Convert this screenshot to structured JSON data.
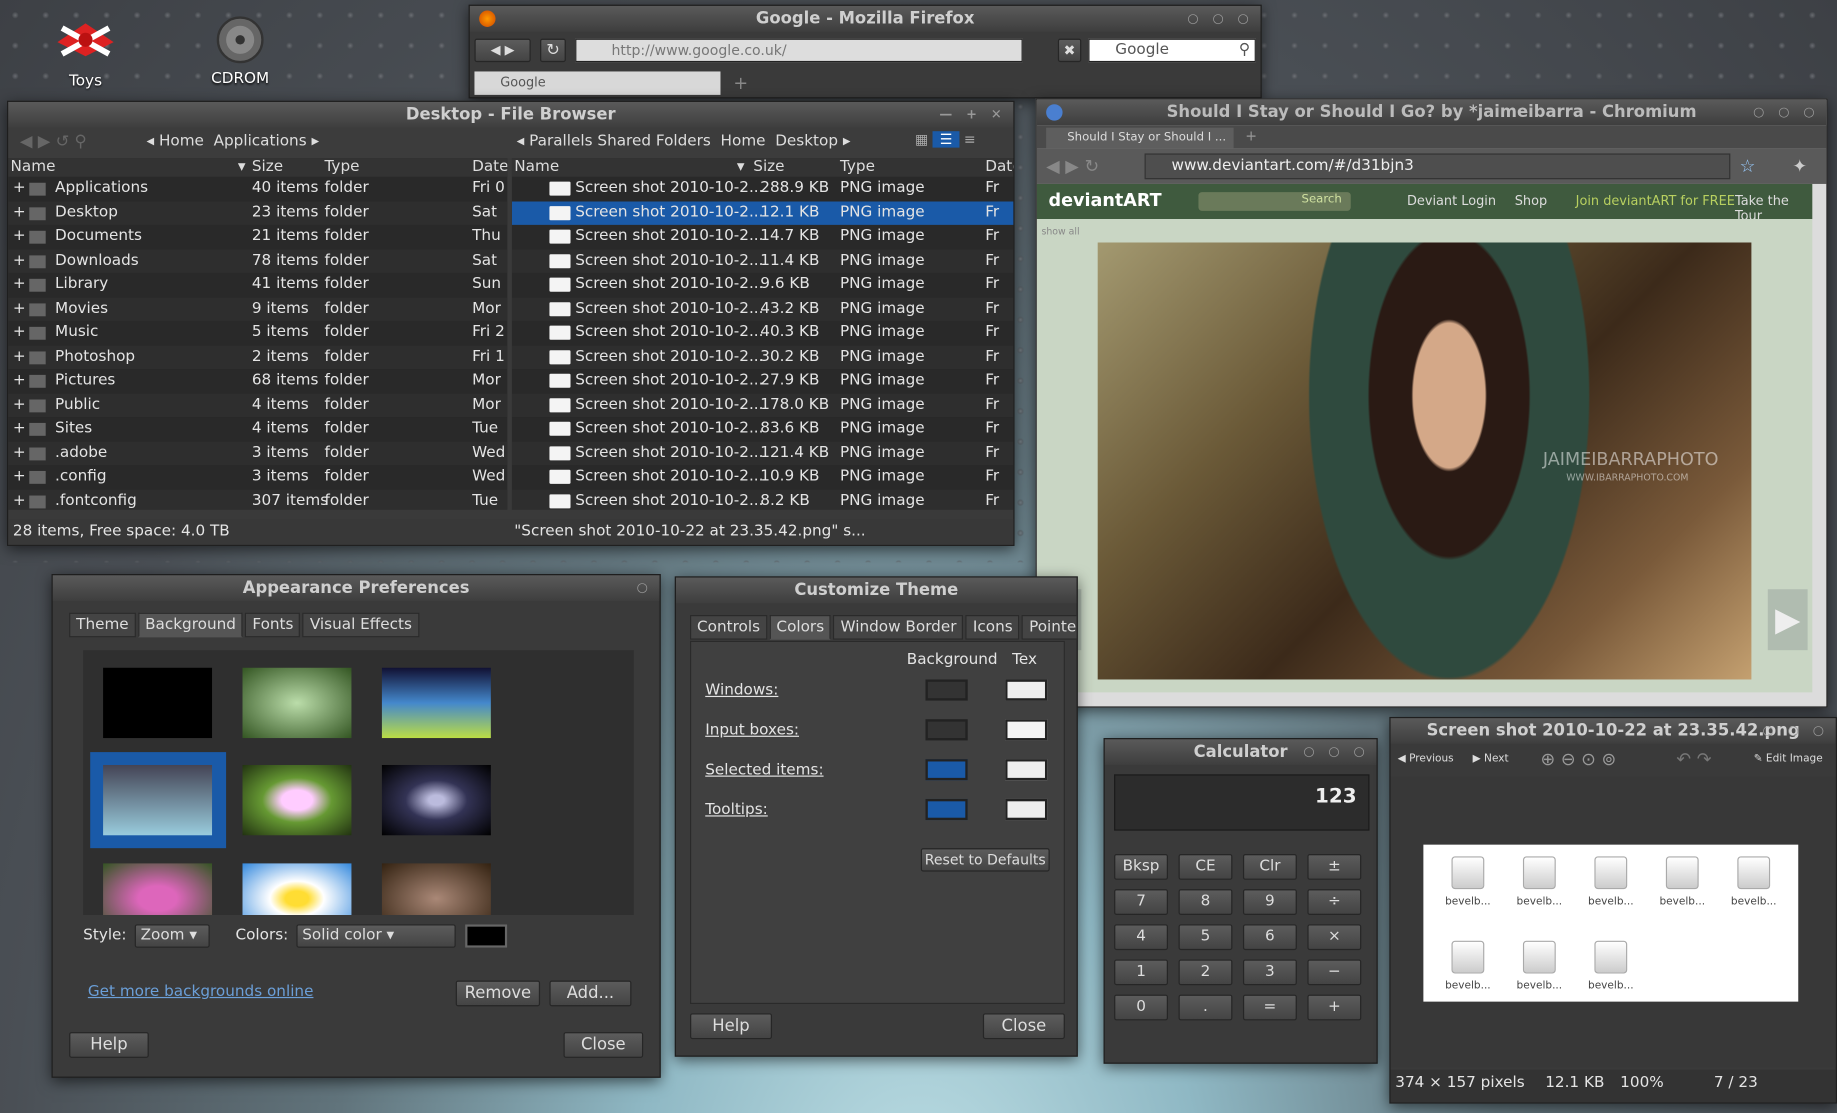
{
  "desktop": {
    "icons": [
      {
        "label": "Toys"
      },
      {
        "label": "CDROM"
      }
    ]
  },
  "firefox": {
    "title": "Google - Mozilla Firefox",
    "url": "http://www.google.co.uk/",
    "search_placeholder": "Google",
    "tab": "Google"
  },
  "filebrowser": {
    "title": "Desktop - File Browser",
    "left_path": [
      "Home",
      "Applications"
    ],
    "right_path": [
      "Parallels Shared Folders",
      "Home",
      "Desktop"
    ],
    "cols": {
      "name": "Name",
      "size": "Size",
      "type": "Type",
      "date": "Date"
    },
    "left_rows": [
      {
        "name": "Applications",
        "size": "40 items",
        "type": "folder",
        "date": "Fri 0"
      },
      {
        "name": "Desktop",
        "size": "23 items",
        "type": "folder",
        "date": "Sat"
      },
      {
        "name": "Documents",
        "size": "21 items",
        "type": "folder",
        "date": "Thu"
      },
      {
        "name": "Downloads",
        "size": "78 items",
        "type": "folder",
        "date": "Sat"
      },
      {
        "name": "Library",
        "size": "41 items",
        "type": "folder",
        "date": "Sun"
      },
      {
        "name": "Movies",
        "size": "9 items",
        "type": "folder",
        "date": "Mor"
      },
      {
        "name": "Music",
        "size": "5 items",
        "type": "folder",
        "date": "Fri 2"
      },
      {
        "name": "Photoshop",
        "size": "2 items",
        "type": "folder",
        "date": "Fri 1"
      },
      {
        "name": "Pictures",
        "size": "68 items",
        "type": "folder",
        "date": "Mor"
      },
      {
        "name": "Public",
        "size": "4 items",
        "type": "folder",
        "date": "Mor"
      },
      {
        "name": "Sites",
        "size": "4 items",
        "type": "folder",
        "date": "Tue"
      },
      {
        "name": ".adobe",
        "size": "3 items",
        "type": "folder",
        "date": "Wed"
      },
      {
        "name": ".config",
        "size": "3 items",
        "type": "folder",
        "date": "Wed"
      },
      {
        "name": ".fontconfig",
        "size": "307 items",
        "type": "folder",
        "date": "Tue"
      }
    ],
    "right_rows": [
      {
        "name": "Screen shot 2010-10-2...",
        "size": "288.9 KB",
        "type": "PNG image",
        "date": "Fr"
      },
      {
        "name": "Screen shot 2010-10-2...",
        "size": "12.1 KB",
        "type": "PNG image",
        "date": "Fr"
      },
      {
        "name": "Screen shot 2010-10-2...",
        "size": "14.7 KB",
        "type": "PNG image",
        "date": "Fr"
      },
      {
        "name": "Screen shot 2010-10-2...",
        "size": "11.4 KB",
        "type": "PNG image",
        "date": "Fr"
      },
      {
        "name": "Screen shot 2010-10-2...",
        "size": "9.6 KB",
        "type": "PNG image",
        "date": "Fr"
      },
      {
        "name": "Screen shot 2010-10-2...",
        "size": "43.2 KB",
        "type": "PNG image",
        "date": "Fr"
      },
      {
        "name": "Screen shot 2010-10-2...",
        "size": "40.3 KB",
        "type": "PNG image",
        "date": "Fr"
      },
      {
        "name": "Screen shot 2010-10-2...",
        "size": "30.2 KB",
        "type": "PNG image",
        "date": "Fr"
      },
      {
        "name": "Screen shot 2010-10-2...",
        "size": "27.9 KB",
        "type": "PNG image",
        "date": "Fr"
      },
      {
        "name": "Screen shot 2010-10-2...",
        "size": "178.0 KB",
        "type": "PNG image",
        "date": "Fr"
      },
      {
        "name": "Screen shot 2010-10-2...",
        "size": "83.6 KB",
        "type": "PNG image",
        "date": "Fr"
      },
      {
        "name": "Screen shot 2010-10-2...",
        "size": "121.4 KB",
        "type": "PNG image",
        "date": "Fr"
      },
      {
        "name": "Screen shot 2010-10-2...",
        "size": "10.9 KB",
        "type": "PNG image",
        "date": "Fr"
      },
      {
        "name": "Screen shot 2010-10-2...",
        "size": "8.2 KB",
        "type": "PNG image",
        "date": "Fr"
      }
    ],
    "status_left": "28 items, Free space: 4.0 TB",
    "status_right": "\"Screen shot 2010-10-22 at 23.35.42.png\" s..."
  },
  "chromium": {
    "title": "Should I Stay or Should I Go? by *jaimeibarra - Chromium",
    "tab": "Should I Stay or Should I ...",
    "url": "www.deviantart.com/#/d31bjn3",
    "logo": "deviantART",
    "search_btn": "Search",
    "nav": [
      "Deviant Login",
      "Shop",
      "Join deviantART for FREE",
      "Take the Tour"
    ],
    "show_all": "show all",
    "watermark": "JAIMEIBARRAPHOTO",
    "watermark2": "WWW.IBARRAPHOTO.COM"
  },
  "appearance": {
    "title": "Appearance Preferences",
    "tabs": [
      "Theme",
      "Background",
      "Fonts",
      "Visual Effects"
    ],
    "style_label": "Style:",
    "style_value": "Zoom",
    "colors_label": "Colors:",
    "colors_value": "Solid color",
    "link": "Get more backgrounds online",
    "remove": "Remove",
    "add": "Add...",
    "help": "Help",
    "close": "Close"
  },
  "customize": {
    "title": "Customize Theme",
    "tabs": [
      "Controls",
      "Colors",
      "Window Border",
      "Icons",
      "Pointe"
    ],
    "col_bg": "Background",
    "col_text": "Tex",
    "rows": [
      {
        "label": "Windows:",
        "bg": "#333333",
        "fg": "#eeeeee"
      },
      {
        "label": "Input boxes:",
        "bg": "#333333",
        "fg": "#f4f4f4"
      },
      {
        "label": "Selected items:",
        "bg": "#1a5aa8",
        "fg": "#eeeeee"
      },
      {
        "label": "Tooltips:",
        "bg": "#1a5aa8",
        "fg": "#eeeeee"
      }
    ],
    "reset": "Reset to Defaults",
    "help": "Help",
    "close": "Close"
  },
  "calculator": {
    "title": "Calculator",
    "display": "123",
    "keys": [
      "Bksp",
      "CE",
      "Clr",
      "±",
      "7",
      "8",
      "9",
      "÷",
      "4",
      "5",
      "6",
      "×",
      "1",
      "2",
      "3",
      "−",
      "0",
      ".",
      "=",
      "+"
    ]
  },
  "viewer": {
    "title": "Screen shot 2010-10-22 at 23.35.42.png",
    "prev": "Previous",
    "next": "Next",
    "edit": "Edit Image",
    "thumb_label": "bevelb...",
    "status_dims": "374 × 157 pixels",
    "status_size": "12.1 KB",
    "status_zoom": "100%",
    "status_count": "7 / 23"
  }
}
